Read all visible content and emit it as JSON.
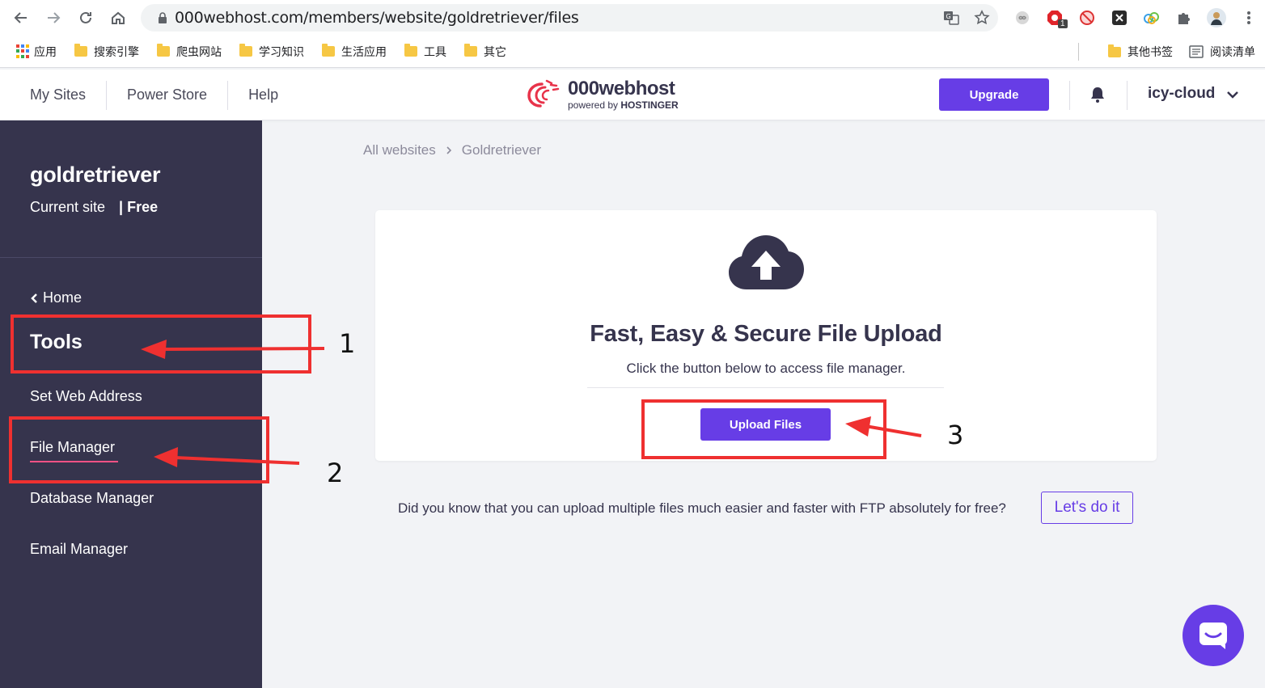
{
  "browser": {
    "url": "000webhost.com/members/website/goldretriever/files",
    "bookmarks": [
      "应用",
      "搜索引擎",
      "爬虫网站",
      "学习知识",
      "生活应用",
      "工具",
      "其它"
    ],
    "other_bookmarks": "其他书签",
    "reading_list": "阅读清单",
    "ext_badge": "1"
  },
  "header": {
    "nav": [
      "My Sites",
      "Power Store",
      "Help"
    ],
    "logo_main": "000webhost",
    "logo_sub_prefix": "powered by ",
    "logo_sub_brand": "HOSTINGER",
    "upgrade_label": "Upgrade",
    "user_name": "icy-cloud"
  },
  "sidebar": {
    "site_name": "goldretriever",
    "current_site": "Current site",
    "plan": "| Free",
    "home": "Home",
    "tools_heading": "Tools",
    "items": [
      "Set Web Address",
      "File Manager",
      "Database Manager",
      "Email Manager"
    ]
  },
  "breadcrumb": [
    "All websites",
    "Goldretriever"
  ],
  "card": {
    "title": "Fast, Easy & Secure File Upload",
    "subtitle": "Click the button below to access file manager.",
    "button": "Upload Files"
  },
  "ftp": {
    "text": "Did you know that you can upload multiple files much easier and faster with FTP absolutely for free?",
    "button": "Let's do it"
  },
  "annotations": [
    "1",
    "2",
    "3"
  ],
  "colors": {
    "accent": "#673de6",
    "sidebar": "#36344d",
    "annotation": "#ef3030",
    "active_underline": "#fc5185"
  }
}
